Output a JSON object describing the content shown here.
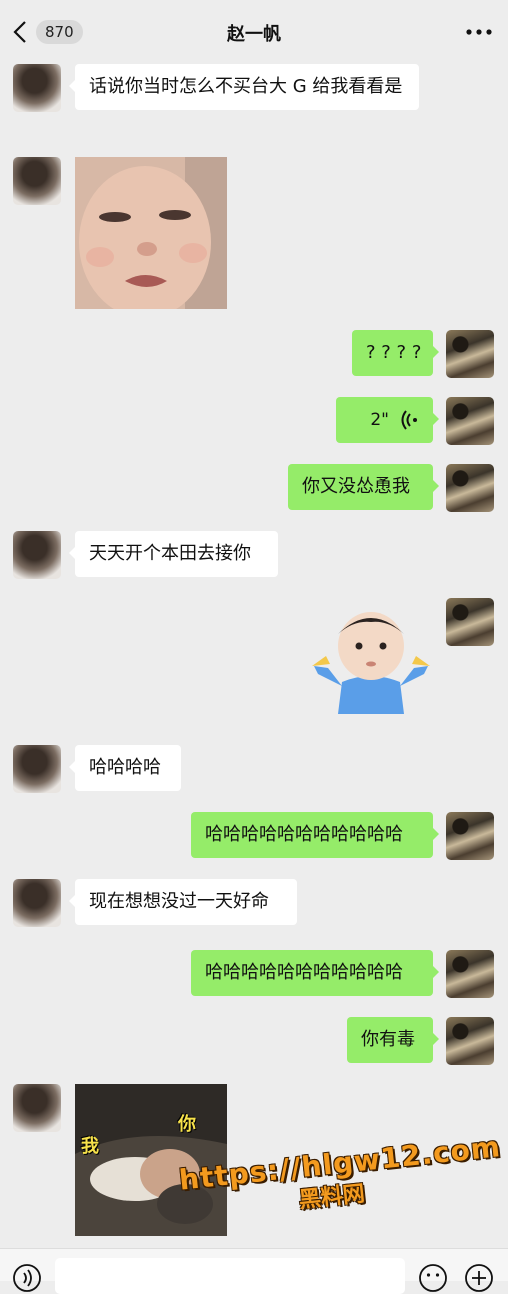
{
  "header": {
    "unread_count": "870",
    "title": "赵一帆"
  },
  "messages": [
    {
      "side": "left",
      "type": "text",
      "text": "话说你当时怎么不买台大 G 给我看看是"
    },
    {
      "side": "left",
      "type": "sticker",
      "sticker": "baby-face-closeup"
    },
    {
      "side": "right",
      "type": "text",
      "text": "? ? ? ?"
    },
    {
      "side": "right",
      "type": "voice",
      "duration": "2\""
    },
    {
      "side": "right",
      "type": "text",
      "text": "你又没怂恿我"
    },
    {
      "side": "left",
      "type": "text",
      "text": "天天开个本田去接你"
    },
    {
      "side": "right",
      "type": "sticker",
      "sticker": "baby-shrug"
    },
    {
      "side": "left",
      "type": "text",
      "text": "哈哈哈哈"
    },
    {
      "side": "right",
      "type": "text",
      "text": "哈哈哈哈哈哈哈哈哈哈哈"
    },
    {
      "side": "left",
      "type": "text",
      "text": "现在想想没过一天好命"
    },
    {
      "side": "right",
      "type": "text",
      "text": "哈哈哈哈哈哈哈哈哈哈哈"
    },
    {
      "side": "right",
      "type": "text",
      "text": "你有毒"
    },
    {
      "side": "left",
      "type": "sticker",
      "sticker": "wo-ni-meme",
      "labels": [
        "我",
        "你"
      ]
    }
  ],
  "watermark": {
    "url": "https://hlgw12.com",
    "name": "黑料网"
  },
  "colors": {
    "background": "#ededed",
    "bubble_left": "#ffffff",
    "bubble_right": "#95ec69",
    "watermark": "#f39a1e"
  }
}
